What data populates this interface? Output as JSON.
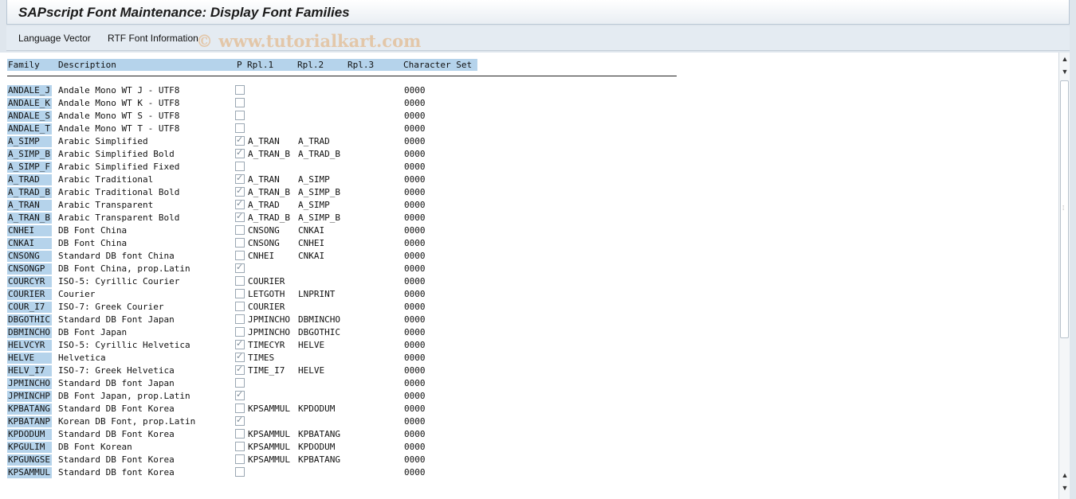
{
  "window": {
    "title": "SAPscript Font Maintenance: Display Font Families"
  },
  "toolbar": {
    "language_vector": "Language Vector",
    "rtf_font_info": "RTF Font Information"
  },
  "watermark": "© www.tutorialkart.com",
  "table": {
    "headers": {
      "family": "Family",
      "description": "Description",
      "p": "P",
      "rpl1": "Rpl.1",
      "rpl2": "Rpl.2",
      "rpl3": "Rpl.3",
      "charset": "Character Set"
    },
    "rows": [
      {
        "family": "ANDALE_J",
        "description": "Andale Mono WT J - UTF8",
        "checked": false,
        "rpl1": "",
        "rpl2": "",
        "rpl3": "",
        "charset": "0000"
      },
      {
        "family": "ANDALE_K",
        "description": "Andale Mono WT K - UTF8",
        "checked": false,
        "rpl1": "",
        "rpl2": "",
        "rpl3": "",
        "charset": "0000"
      },
      {
        "family": "ANDALE_S",
        "description": "Andale Mono WT S - UTF8",
        "checked": false,
        "rpl1": "",
        "rpl2": "",
        "rpl3": "",
        "charset": "0000"
      },
      {
        "family": "ANDALE_T",
        "description": "Andale Mono WT T - UTF8",
        "checked": false,
        "rpl1": "",
        "rpl2": "",
        "rpl3": "",
        "charset": "0000"
      },
      {
        "family": "A_SIMP",
        "description": "Arabic Simplified",
        "checked": true,
        "rpl1": "A_TRAN",
        "rpl2": "A_TRAD",
        "rpl3": "",
        "charset": "0000"
      },
      {
        "family": "A_SIMP_B",
        "description": "Arabic Simplified Bold",
        "checked": true,
        "rpl1": "A_TRAN_B",
        "rpl2": "A_TRAD_B",
        "rpl3": "",
        "charset": "0000"
      },
      {
        "family": "A_SIMP_F",
        "description": "Arabic Simplified Fixed",
        "checked": false,
        "rpl1": "",
        "rpl2": "",
        "rpl3": "",
        "charset": "0000"
      },
      {
        "family": "A_TRAD",
        "description": "Arabic Traditional",
        "checked": true,
        "rpl1": "A_TRAN",
        "rpl2": "A_SIMP",
        "rpl3": "",
        "charset": "0000"
      },
      {
        "family": "A_TRAD_B",
        "description": "Arabic Traditional Bold",
        "checked": true,
        "rpl1": "A_TRAN_B",
        "rpl2": "A_SIMP_B",
        "rpl3": "",
        "charset": "0000"
      },
      {
        "family": "A_TRAN",
        "description": "Arabic Transparent",
        "checked": true,
        "rpl1": "A_TRAD",
        "rpl2": "A_SIMP",
        "rpl3": "",
        "charset": "0000"
      },
      {
        "family": "A_TRAN_B",
        "description": "Arabic Transparent Bold",
        "checked": true,
        "rpl1": "A_TRAD_B",
        "rpl2": "A_SIMP_B",
        "rpl3": "",
        "charset": "0000"
      },
      {
        "family": "CNHEI",
        "description": "DB Font China",
        "checked": false,
        "rpl1": "CNSONG",
        "rpl2": "CNKAI",
        "rpl3": "",
        "charset": "0000"
      },
      {
        "family": "CNKAI",
        "description": "DB Font China",
        "checked": false,
        "rpl1": "CNSONG",
        "rpl2": "CNHEI",
        "rpl3": "",
        "charset": "0000"
      },
      {
        "family": "CNSONG",
        "description": "Standard DB font China",
        "checked": false,
        "rpl1": "CNHEI",
        "rpl2": "CNKAI",
        "rpl3": "",
        "charset": "0000"
      },
      {
        "family": "CNSONGP",
        "description": "DB Font China, prop.Latin",
        "checked": true,
        "rpl1": "",
        "rpl2": "",
        "rpl3": "",
        "charset": "0000"
      },
      {
        "family": "COURCYR",
        "description": "ISO-5: Cyrillic Courier",
        "checked": false,
        "rpl1": "COURIER",
        "rpl2": "",
        "rpl3": "",
        "charset": "0000"
      },
      {
        "family": "COURIER",
        "description": "Courier",
        "checked": false,
        "rpl1": "LETGOTH",
        "rpl2": "LNPRINT",
        "rpl3": "",
        "charset": "0000"
      },
      {
        "family": "COUR_I7",
        "description": "ISO-7: Greek Courier",
        "checked": false,
        "rpl1": "COURIER",
        "rpl2": "",
        "rpl3": "",
        "charset": "0000"
      },
      {
        "family": "DBGOTHIC",
        "description": "Standard DB Font Japan",
        "checked": false,
        "rpl1": "JPMINCHO",
        "rpl2": "DBMINCHO",
        "rpl3": "",
        "charset": "0000"
      },
      {
        "family": "DBMINCHO",
        "description": "DB Font Japan",
        "checked": false,
        "rpl1": "JPMINCHO",
        "rpl2": "DBGOTHIC",
        "rpl3": "",
        "charset": "0000"
      },
      {
        "family": "HELVCYR",
        "description": "ISO-5: Cyrillic Helvetica",
        "checked": true,
        "rpl1": "TIMECYR",
        "rpl2": "HELVE",
        "rpl3": "",
        "charset": "0000"
      },
      {
        "family": "HELVE",
        "description": "Helvetica",
        "checked": true,
        "rpl1": "TIMES",
        "rpl2": "",
        "rpl3": "",
        "charset": "0000"
      },
      {
        "family": "HELV_I7",
        "description": "ISO-7: Greek Helvetica",
        "checked": true,
        "rpl1": "TIME_I7",
        "rpl2": "HELVE",
        "rpl3": "",
        "charset": "0000"
      },
      {
        "family": "JPMINCHO",
        "description": "Standard DB font Japan",
        "checked": false,
        "rpl1": "",
        "rpl2": "",
        "rpl3": "",
        "charset": "0000"
      },
      {
        "family": "JPMINCHP",
        "description": "DB Font Japan, prop.Latin",
        "checked": true,
        "rpl1": "",
        "rpl2": "",
        "rpl3": "",
        "charset": "0000"
      },
      {
        "family": "KPBATANG",
        "description": "Standard DB Font Korea",
        "checked": false,
        "rpl1": "KPSAMMUL",
        "rpl2": "KPDODUM",
        "rpl3": "",
        "charset": "0000"
      },
      {
        "family": "KPBATANP",
        "description": "Korean DB Font, prop.Latin",
        "checked": true,
        "rpl1": "",
        "rpl2": "",
        "rpl3": "",
        "charset": "0000"
      },
      {
        "family": "KPDODUM",
        "description": "Standard DB Font Korea",
        "checked": false,
        "rpl1": "KPSAMMUL",
        "rpl2": "KPBATANG",
        "rpl3": "",
        "charset": "0000"
      },
      {
        "family": "KPGULIM",
        "description": "DB Font Korean",
        "checked": false,
        "rpl1": "KPSAMMUL",
        "rpl2": "KPDODUM",
        "rpl3": "",
        "charset": "0000"
      },
      {
        "family": "KPGUNGSE",
        "description": "Standard DB Font Korea",
        "checked": false,
        "rpl1": "KPSAMMUL",
        "rpl2": "KPBATANG",
        "rpl3": "",
        "charset": "0000"
      },
      {
        "family": "KPSAMMUL",
        "description": "Standard DB font Korea",
        "checked": false,
        "rpl1": "",
        "rpl2": "",
        "rpl3": "",
        "charset": "0000"
      }
    ]
  },
  "colors": {
    "header_bg": "#b5d3eb",
    "family_cell_bg": "#b5d3eb",
    "chrome_bg": "#dfe6ed"
  },
  "icons": {
    "scroll_up": "triangle-up-icon",
    "scroll_down": "triangle-down-icon"
  }
}
